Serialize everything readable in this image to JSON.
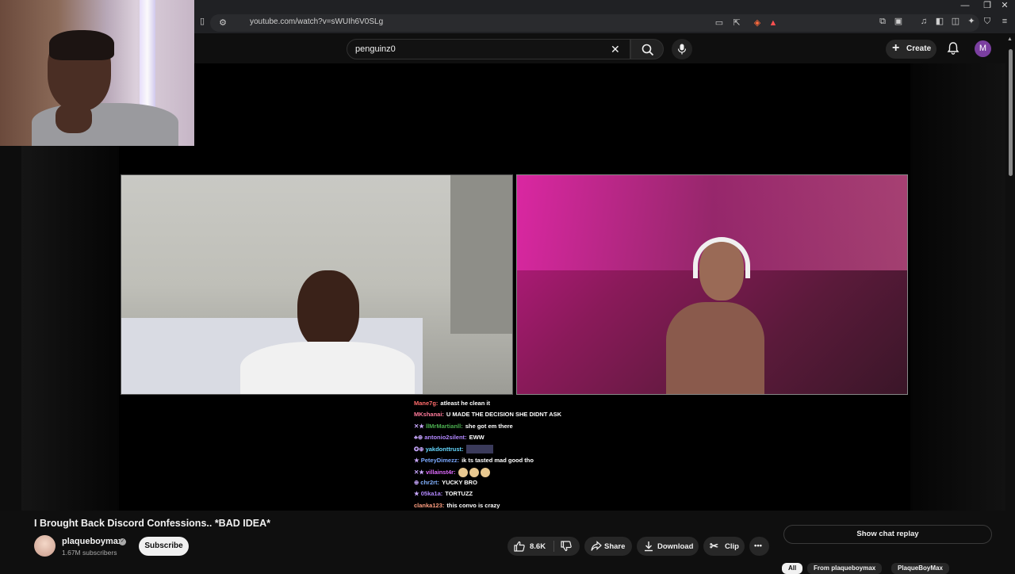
{
  "browser": {
    "url": "youtube.com/watch?v=sWUIh6V0SLg"
  },
  "header": {
    "search_value": "penguinz0",
    "create_label": "Create",
    "avatar_letter": "M"
  },
  "chat": [
    {
      "user": "Mane7g:",
      "user_color": "#ff6b6b",
      "badges": "",
      "msg": "atleast he clean it"
    },
    {
      "user": "MKshanai:",
      "user_color": "#ff7a9a",
      "badges": "",
      "msg": "U MADE THE DECISION SHE DIDNT ASK"
    },
    {
      "user": "llMrMartianll:",
      "user_color": "#4caf50",
      "badges": "✕★",
      "msg": "she got em there"
    },
    {
      "user": "antonio2silent:",
      "user_color": "#b388ff",
      "badges": "♣⊕",
      "msg": "EWW"
    },
    {
      "user": "yakdonttrust:",
      "user_color": "#64d8ff",
      "badges": "✪⊕",
      "msg": "",
      "emote_image": true
    },
    {
      "user": "PeteyDimezz:",
      "user_color": "#7aa8ff",
      "badges": "★",
      "msg": "ik ts tasted mad good tho"
    },
    {
      "user": "villainst4r:",
      "user_color": "#e06cff",
      "badges": "✕★",
      "msg": "",
      "emotes": 3
    },
    {
      "user": "chr2rt:",
      "user_color": "#82b1ff",
      "badges": "⊕",
      "msg": "YUCKY BRO"
    },
    {
      "user": "05ka1a:",
      "user_color": "#b388ff",
      "badges": "★",
      "msg": "TORTUZZ"
    },
    {
      "user": "clanka123:",
      "user_color": "#ff9e80",
      "badges": "",
      "msg": "this convo is crazy"
    }
  ],
  "video": {
    "title": "I Brought Back Discord Confessions.. *BAD IDEA*",
    "channel_name": "plaqueboymax",
    "subscribers": "1.67M subscribers",
    "subscribe_label": "Subscribe"
  },
  "actions": {
    "like_count": "8.6K",
    "share_label": "Share",
    "download_label": "Download",
    "clip_label": "Clip",
    "more_label": "•••"
  },
  "sidebar": {
    "show_chat_replay": "Show chat replay",
    "chips": [
      "All",
      "From plaqueboymax",
      "PlaqueBoyMax"
    ]
  },
  "icons": [
    "search-icon",
    "close-icon",
    "mic-icon",
    "bell-icon",
    "thumb-up-icon",
    "thumb-down-icon",
    "share-icon",
    "download-icon",
    "scissors-icon",
    "more-icon",
    "bookmark-icon",
    "plus-icon"
  ]
}
